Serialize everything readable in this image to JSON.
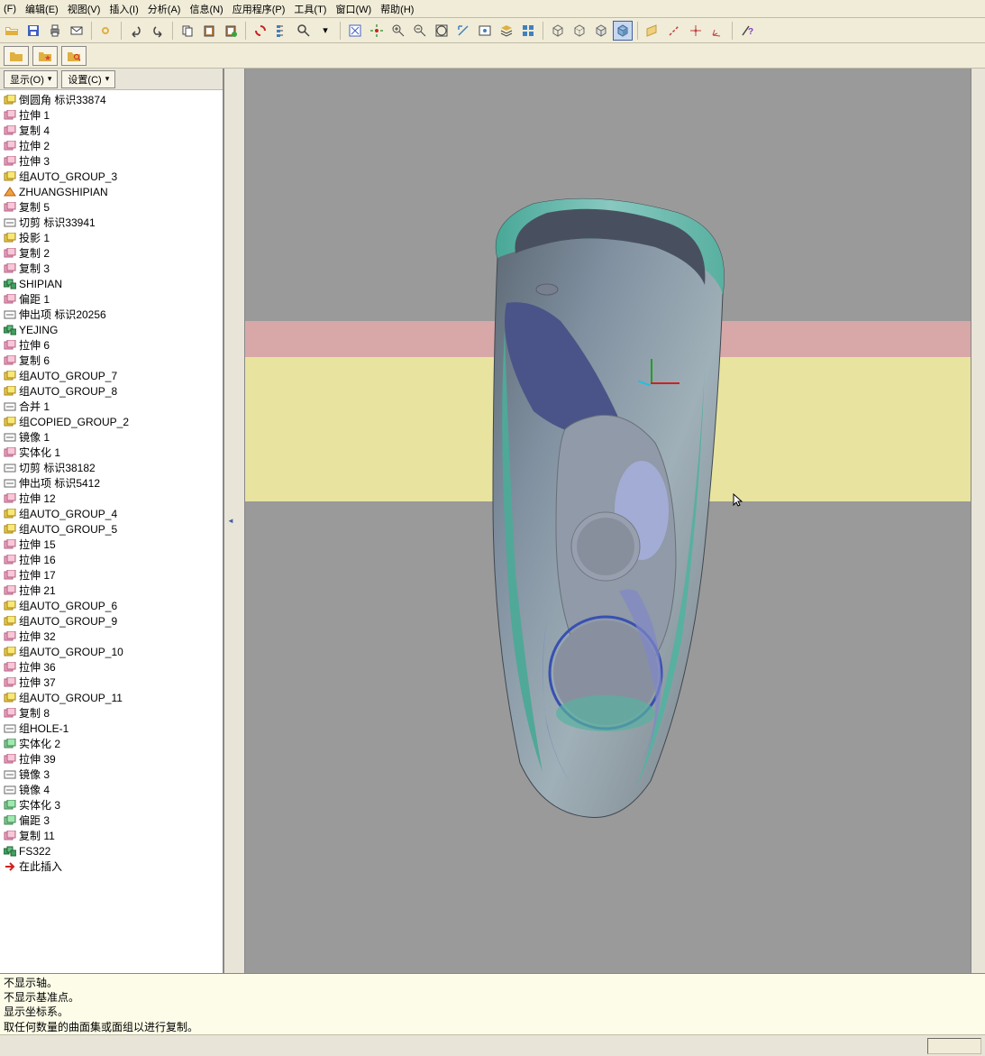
{
  "menu": {
    "items": [
      "(F)",
      "编辑(E)",
      "视图(V)",
      "插入(I)",
      "分析(A)",
      "信息(N)",
      "应用程序(P)",
      "工具(T)",
      "窗口(W)",
      "帮助(H)"
    ]
  },
  "sidebar": {
    "display_btn": "显示(O)",
    "settings_btn": "设置(C)"
  },
  "tree": [
    {
      "icon": "feat-yellow",
      "label": "倒圆角 标识33874"
    },
    {
      "icon": "feat-pink",
      "label": "拉伸 1"
    },
    {
      "icon": "feat-pink",
      "label": "复制 4"
    },
    {
      "icon": "feat-pink",
      "label": "拉伸 2"
    },
    {
      "icon": "feat-pink",
      "label": "拉伸 3"
    },
    {
      "icon": "feat-yellow",
      "label": "组AUTO_GROUP_3"
    },
    {
      "icon": "feat-orange",
      "label": "ZHUANGSHIPIAN"
    },
    {
      "icon": "feat-pink",
      "label": "复制 5"
    },
    {
      "icon": "feat-cut",
      "label": "切剪 标识33941"
    },
    {
      "icon": "feat-yellow",
      "label": "投影 1"
    },
    {
      "icon": "feat-pink",
      "label": "复制 2"
    },
    {
      "icon": "feat-pink",
      "label": "复制 3"
    },
    {
      "icon": "feat-group",
      "label": "SHIPIAN"
    },
    {
      "icon": "feat-pink",
      "label": "偏距 1"
    },
    {
      "icon": "feat-cut",
      "label": "伸出项 标识20256"
    },
    {
      "icon": "feat-group",
      "label": "YEJING"
    },
    {
      "icon": "feat-pink",
      "label": "拉伸 6"
    },
    {
      "icon": "feat-pink",
      "label": "复制 6"
    },
    {
      "icon": "feat-yellow",
      "label": "组AUTO_GROUP_7"
    },
    {
      "icon": "feat-yellow",
      "label": "组AUTO_GROUP_8"
    },
    {
      "icon": "feat-cut",
      "label": "合并 1"
    },
    {
      "icon": "feat-yellow",
      "label": "组COPIED_GROUP_2"
    },
    {
      "icon": "feat-cut",
      "label": "镜像 1"
    },
    {
      "icon": "feat-pink",
      "label": "实体化 1"
    },
    {
      "icon": "feat-cut",
      "label": "切剪 标识38182"
    },
    {
      "icon": "feat-cut",
      "label": "伸出项 标识5412"
    },
    {
      "icon": "feat-pink",
      "label": "拉伸 12"
    },
    {
      "icon": "feat-yellow",
      "label": "组AUTO_GROUP_4"
    },
    {
      "icon": "feat-yellow",
      "label": "组AUTO_GROUP_5"
    },
    {
      "icon": "feat-pink",
      "label": "拉伸 15"
    },
    {
      "icon": "feat-pink",
      "label": "拉伸 16"
    },
    {
      "icon": "feat-pink",
      "label": "拉伸 17"
    },
    {
      "icon": "feat-pink",
      "label": "拉伸 21"
    },
    {
      "icon": "feat-yellow",
      "label": "组AUTO_GROUP_6"
    },
    {
      "icon": "feat-yellow",
      "label": "组AUTO_GROUP_9"
    },
    {
      "icon": "feat-pink",
      "label": "拉伸 32"
    },
    {
      "icon": "feat-yellow",
      "label": "组AUTO_GROUP_10"
    },
    {
      "icon": "feat-pink",
      "label": "拉伸 36"
    },
    {
      "icon": "feat-pink",
      "label": "拉伸 37"
    },
    {
      "icon": "feat-yellow",
      "label": "组AUTO_GROUP_11"
    },
    {
      "icon": "feat-pink",
      "label": "复制 8"
    },
    {
      "icon": "feat-cut",
      "label": "组HOLE-1"
    },
    {
      "icon": "feat-green",
      "label": "实体化 2"
    },
    {
      "icon": "feat-pink",
      "label": "拉伸 39"
    },
    {
      "icon": "feat-cut",
      "label": "镜像 3"
    },
    {
      "icon": "feat-cut",
      "label": "镜像 4"
    },
    {
      "icon": "feat-green",
      "label": "实体化 3"
    },
    {
      "icon": "feat-green",
      "label": "偏距 3"
    },
    {
      "icon": "feat-pink",
      "label": "复制 11"
    },
    {
      "icon": "feat-group",
      "label": "FS322"
    },
    {
      "icon": "feat-insert",
      "label": "在此插入"
    }
  ],
  "messages": [
    "不显示轴。",
    "不显示基准点。",
    "显示坐标系。",
    "取任何数量的曲面集或面组以进行复制。"
  ]
}
